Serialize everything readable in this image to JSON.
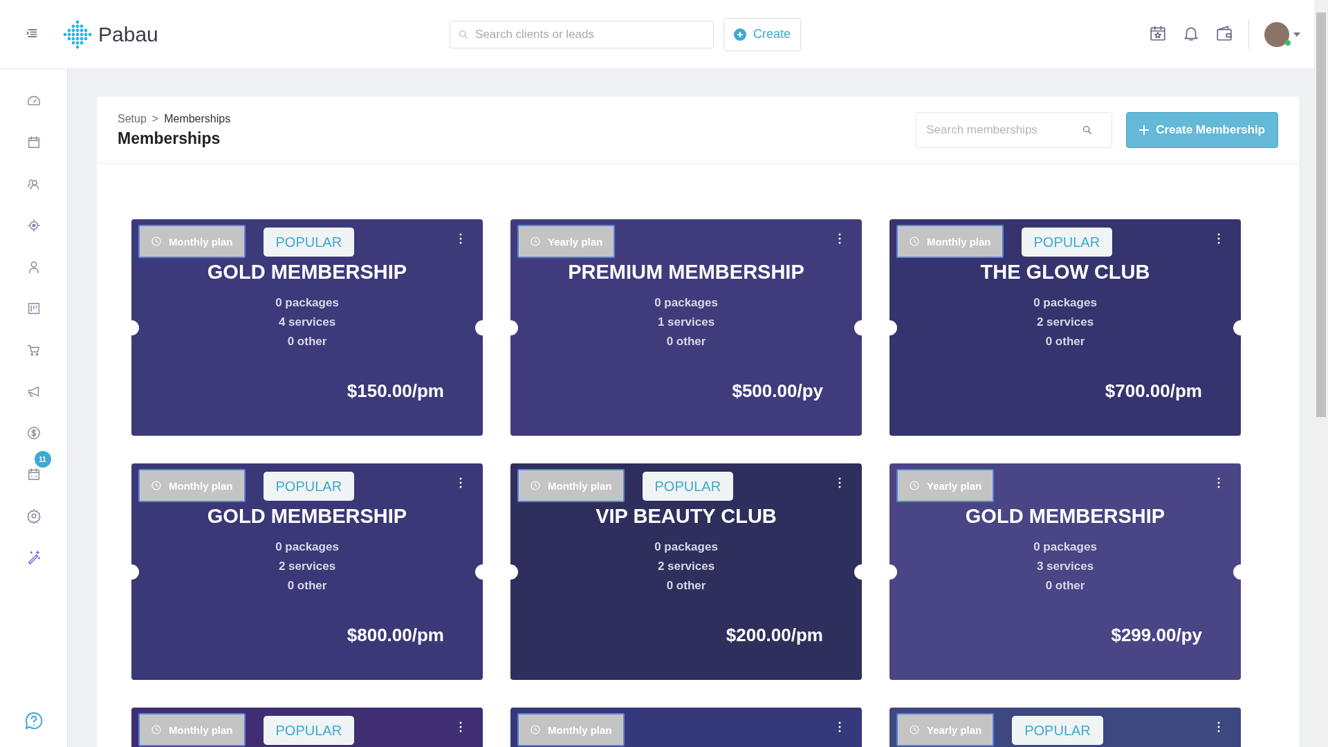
{
  "header": {
    "brand": "Pabau",
    "search": {
      "placeholder": "Search clients or leads"
    },
    "create_button": "Create"
  },
  "sidebar": {
    "items": [
      {
        "kind": "dashboard"
      },
      {
        "kind": "calendar"
      },
      {
        "kind": "leads"
      },
      {
        "kind": "target"
      },
      {
        "kind": "client"
      },
      {
        "kind": "board"
      },
      {
        "kind": "cart"
      },
      {
        "kind": "megaphone"
      },
      {
        "kind": "dollar"
      },
      {
        "kind": "schedule",
        "badge": "11"
      },
      {
        "kind": "settings"
      },
      {
        "kind": "wand"
      }
    ]
  },
  "page": {
    "breadcrumb": [
      "Setup",
      "Memberships"
    ],
    "breadcrumb_separator": ">",
    "title": "Memberships",
    "search": {
      "placeholder": "Search memberships"
    },
    "create_button": "Create Membership"
  },
  "memberships": [
    {
      "plan": "Monthly plan",
      "popular": true,
      "popular_label": "POPULAR",
      "title": "GOLD MEMBERSHIP",
      "lines": [
        "0 packages",
        "4 services",
        "0 other"
      ],
      "price": "$150.00/pm",
      "color": "#3d3a7a"
    },
    {
      "plan": "Yearly plan",
      "popular": false,
      "title": "PREMIUM MEMBERSHIP",
      "lines": [
        "0 packages",
        "1 services",
        "0 other"
      ],
      "price": "$500.00/py",
      "color": "#403c7c"
    },
    {
      "plan": "Monthly plan",
      "popular": true,
      "popular_label": "POPULAR",
      "title": "THE GLOW CLUB",
      "lines": [
        "0 packages",
        "2 services",
        "0 other"
      ],
      "price": "$700.00/pm",
      "color": "#35346e"
    },
    {
      "plan": "Monthly plan",
      "popular": true,
      "popular_label": "POPULAR",
      "title": "GOLD MEMBERSHIP",
      "lines": [
        "0 packages",
        "2 services",
        "0 other"
      ],
      "price": "$800.00/pm",
      "color": "#3b3878"
    },
    {
      "plan": "Monthly plan",
      "popular": true,
      "popular_label": "POPULAR",
      "title": "VIP BEAUTY CLUB",
      "lines": [
        "0 packages",
        "2 services",
        "0 other"
      ],
      "price": "$200.00/pm",
      "color": "#2e2f5c"
    },
    {
      "plan": "Yearly plan",
      "popular": false,
      "title": "GOLD MEMBERSHIP",
      "lines": [
        "0 packages",
        "3 services",
        "0 other"
      ],
      "price": "$299.00/py",
      "color": "#4a4585"
    },
    {
      "plan": "Monthly plan",
      "popular": true,
      "popular_label": "POPULAR",
      "color": "#3f2f72"
    },
    {
      "plan": "Monthly plan",
      "popular": false,
      "color": "#35387a"
    },
    {
      "plan": "Yearly plan",
      "popular": true,
      "popular_label": "POPULAR",
      "color": "#3d4880"
    }
  ]
}
